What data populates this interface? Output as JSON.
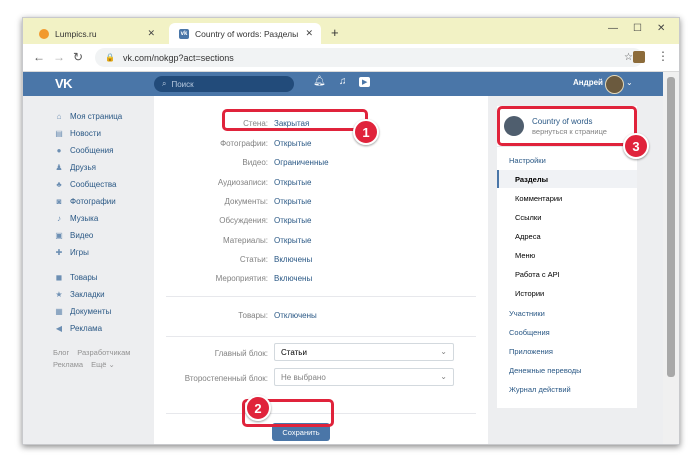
{
  "browser": {
    "tabs": [
      {
        "title": "Lumpics.ru"
      },
      {
        "title": "Country of words: Разделы"
      }
    ],
    "new_tab": "+",
    "url": "vk.com/nokgp?act=sections"
  },
  "vk": {
    "logo": "VK",
    "search_placeholder": "Поиск",
    "user_name": "Андрей"
  },
  "left_menu": {
    "items": [
      {
        "label": "Моя страница",
        "icon": "home-icon"
      },
      {
        "label": "Новости",
        "icon": "news-icon"
      },
      {
        "label": "Сообщения",
        "icon": "messages-icon",
        "count": "1"
      },
      {
        "label": "Друзья",
        "icon": "friends-icon",
        "count": "18"
      },
      {
        "label": "Сообщества",
        "icon": "communities-icon"
      },
      {
        "label": "Фотографии",
        "icon": "photos-icon"
      },
      {
        "label": "Музыка",
        "icon": "music-icon"
      },
      {
        "label": "Видео",
        "icon": "video-icon"
      },
      {
        "label": "Игры",
        "icon": "games-icon",
        "count": "6"
      }
    ],
    "items2": [
      {
        "label": "Товары",
        "icon": "goods-icon"
      },
      {
        "label": "Закладки",
        "icon": "bookmarks-icon"
      },
      {
        "label": "Документы",
        "icon": "documents-icon"
      },
      {
        "label": "Реклама",
        "icon": "ads-icon"
      }
    ],
    "footer": [
      "Блог",
      "Разработчикам",
      "Реклама",
      "Ещё ⌄"
    ]
  },
  "sections": {
    "rows": [
      {
        "label": "Стена:",
        "value": "Закрытая"
      },
      {
        "label": "Фотографии:",
        "value": "Открытые"
      },
      {
        "label": "Видео:",
        "value": "Ограниченные"
      },
      {
        "label": "Аудиозаписи:",
        "value": "Открытые"
      },
      {
        "label": "Документы:",
        "value": "Открытые"
      },
      {
        "label": "Обсуждения:",
        "value": "Открытые"
      },
      {
        "label": "Материалы:",
        "value": "Открытые"
      },
      {
        "label": "Статьи:",
        "value": "Включены"
      },
      {
        "label": "Мероприятия:",
        "value": "Включены"
      }
    ],
    "goods": {
      "label": "Товары:",
      "value": "Отключены"
    },
    "main_block": {
      "label": "Главный блок:",
      "value": "Статьи"
    },
    "secondary_block": {
      "label": "Второстепенный блок:",
      "placeholder": "Не выбрано"
    },
    "save_label": "Сохранить"
  },
  "right_menu": {
    "title": "Country of words",
    "subtitle": "вернуться к странице",
    "items": [
      {
        "label": "Настройки",
        "level": 1
      },
      {
        "label": "Разделы",
        "level": 2,
        "active": true
      },
      {
        "label": "Комментарии",
        "level": 2
      },
      {
        "label": "Ссылки",
        "level": 2
      },
      {
        "label": "Адреса",
        "level": 2
      },
      {
        "label": "Меню",
        "level": 2
      },
      {
        "label": "Работа с API",
        "level": 2
      },
      {
        "label": "Истории",
        "level": 2
      },
      {
        "label": "Участники",
        "level": 1
      },
      {
        "label": "Сообщения",
        "level": 1
      },
      {
        "label": "Приложения",
        "level": 1
      },
      {
        "label": "Денежные переводы",
        "level": 1
      },
      {
        "label": "Журнал действий",
        "level": 1
      }
    ]
  },
  "annotations": {
    "badge1": "1",
    "badge2": "2",
    "badge3": "3"
  },
  "colors": {
    "vk_blue": "#4a76a8",
    "link": "#2a5885",
    "callout": "#e0233b",
    "page_bg": "#edeef0"
  }
}
